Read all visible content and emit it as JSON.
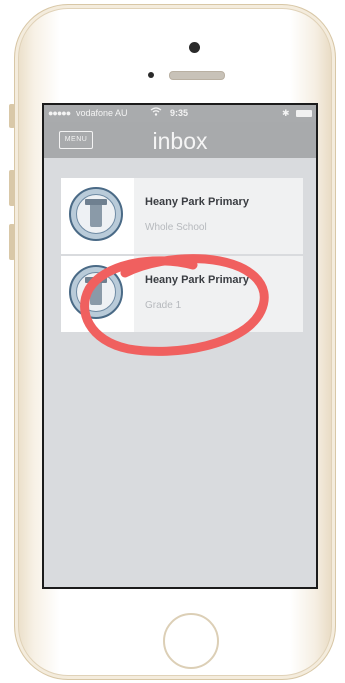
{
  "status_bar": {
    "signal": "●●●●●",
    "carrier": "vodafone AU",
    "time": "9:35",
    "bluetooth": "✱"
  },
  "nav": {
    "menu_label": "MENU",
    "title": "inbox"
  },
  "messages": [
    {
      "title": "Heany Park Primary",
      "subtitle": "Whole School"
    },
    {
      "title": "Heany Park Primary",
      "subtitle": "Grade 1"
    }
  ],
  "colors": {
    "annotation": "#f0605f",
    "nav_bar": "#a8aaac",
    "screen_bg": "#d9dbde"
  }
}
